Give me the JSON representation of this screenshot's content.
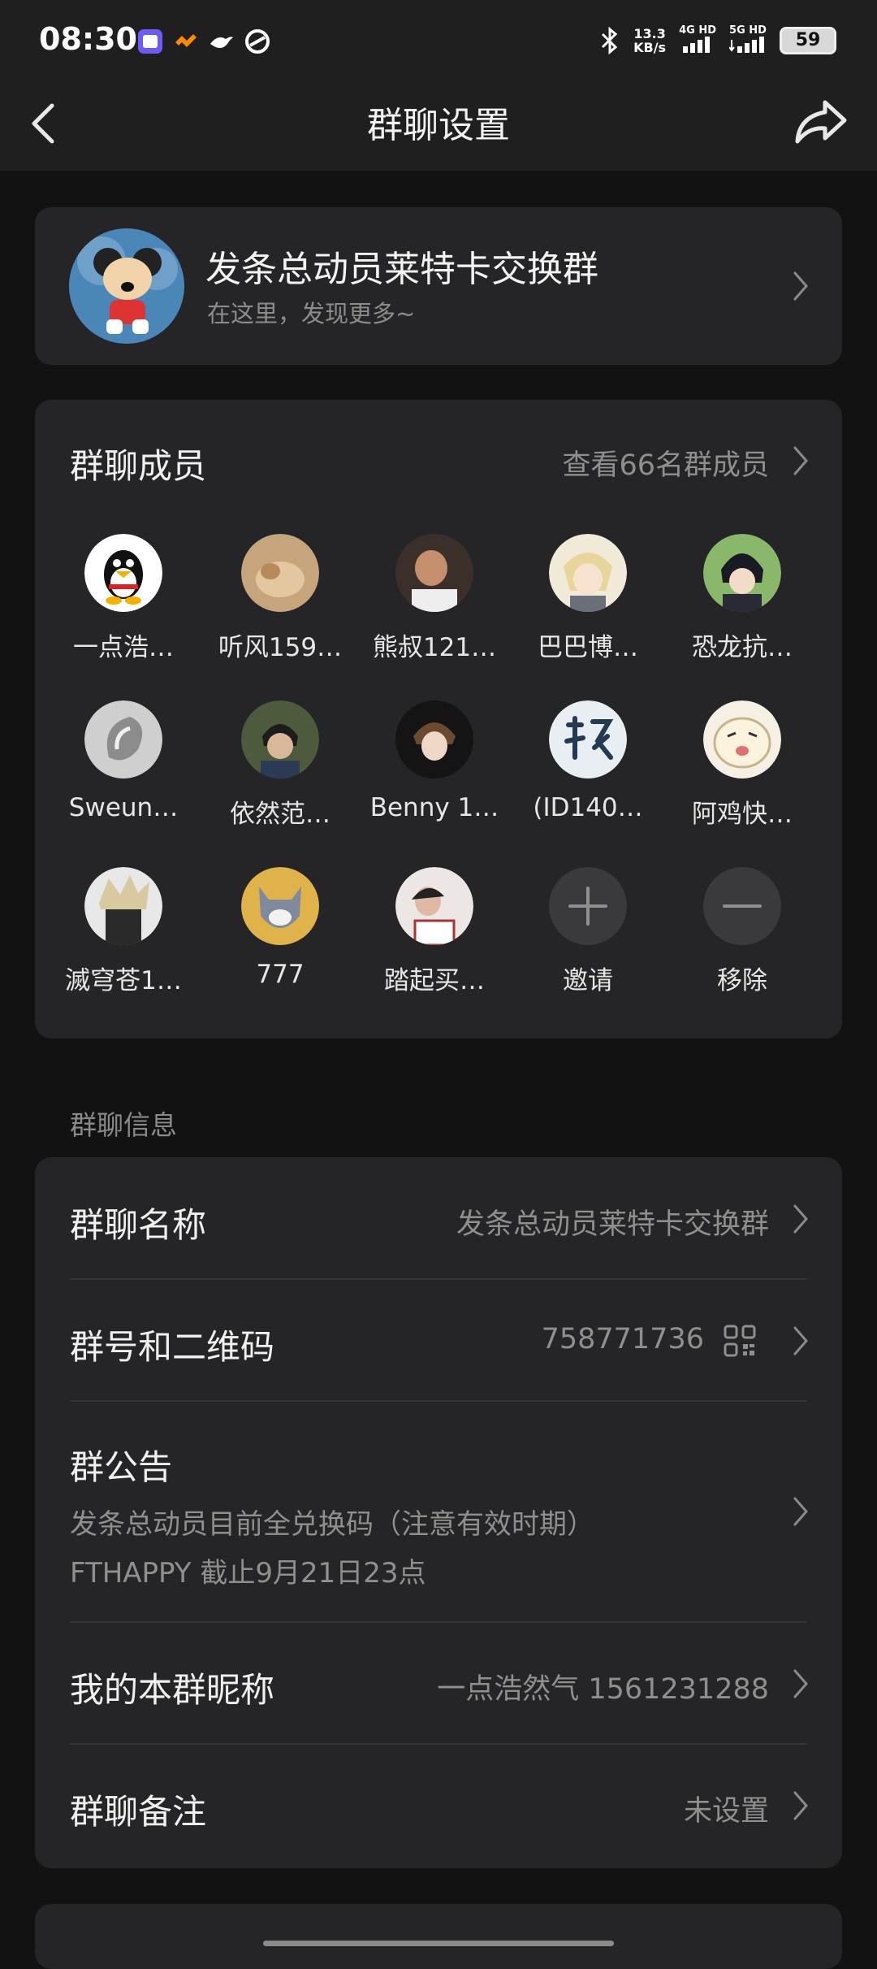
{
  "status": {
    "time": "08:30",
    "speed_value": "13.3",
    "speed_unit": "KB/s",
    "sig1": "4G HD",
    "sig2": "5G HD",
    "battery": "59"
  },
  "nav": {
    "title": "群聊设置",
    "back_icon": "chevron-left-icon",
    "share_icon": "share-arrow-icon"
  },
  "group": {
    "name": "发条总动员莱特卡交换群",
    "subtitle": "在这里，发现更多~"
  },
  "members": {
    "title": "群聊成员",
    "view_all": "查看66名群成员",
    "list": [
      {
        "name": "一点浩…"
      },
      {
        "name": "听风159…"
      },
      {
        "name": "熊叔121…"
      },
      {
        "name": "巴巴博…"
      },
      {
        "name": "恐龙抗…"
      },
      {
        "name": "Sweun…"
      },
      {
        "name": "依然范…"
      },
      {
        "name": "Benny 1…"
      },
      {
        "name": "(ID140…"
      },
      {
        "name": "阿鸡快…"
      },
      {
        "name": "滅穹苍1…"
      },
      {
        "name": "777"
      },
      {
        "name": "踏起买…"
      },
      {
        "name": "邀请"
      },
      {
        "name": "移除"
      }
    ]
  },
  "info": {
    "section_label": "群聊信息",
    "group_name_label": "群聊名称",
    "group_name_value": "发条总动员莱特卡交换群",
    "group_id_label": "群号和二维码",
    "group_id_value": "758771736",
    "notice_label": "群公告",
    "notice_line1": "发条总动员目前全兑换码（注意有效时期）",
    "notice_line2": "FTHAPPY 截止9月21日23点",
    "nickname_label": "我的本群昵称",
    "nickname_value": "一点浩然气 1561231288",
    "remark_label": "群聊备注",
    "remark_value": "未设置"
  }
}
